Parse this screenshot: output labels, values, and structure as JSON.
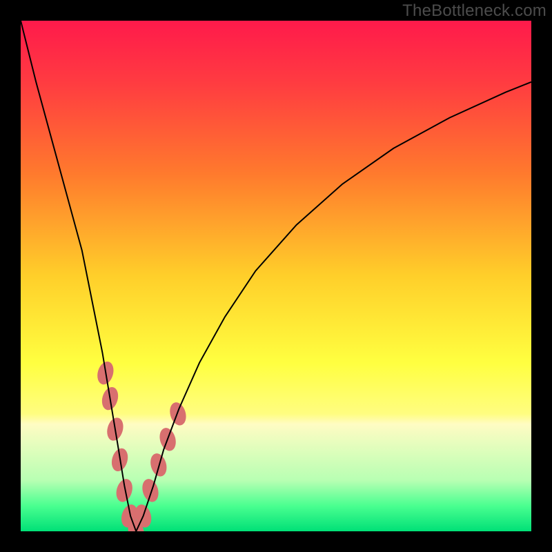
{
  "watermark": "TheBottleneck.com",
  "chart_data": {
    "type": "line",
    "title": "",
    "xlabel": "",
    "ylabel": "",
    "xlim": [
      0,
      100
    ],
    "ylim": [
      0,
      100
    ],
    "grid": false,
    "legend": "none",
    "gradient_stops": [
      {
        "pct": 0,
        "color": "#ff1a4b"
      },
      {
        "pct": 12,
        "color": "#ff3b41"
      },
      {
        "pct": 30,
        "color": "#ff7a2d"
      },
      {
        "pct": 50,
        "color": "#ffcf2a"
      },
      {
        "pct": 67,
        "color": "#ffff40"
      },
      {
        "pct": 77,
        "color": "#fffd80"
      },
      {
        "pct": 79,
        "color": "#fffcc3"
      },
      {
        "pct": 90,
        "color": "#b8ffb3"
      },
      {
        "pct": 95,
        "color": "#4aff90"
      },
      {
        "pct": 100,
        "color": "#00e077"
      }
    ],
    "series": [
      {
        "name": "bottleneck-curve",
        "x": [
          0,
          3,
          6,
          9,
          12,
          14,
          16,
          17.5,
          19,
          20.3,
          21.5,
          22.6,
          24,
          26,
          28,
          31,
          35,
          40,
          46,
          54,
          63,
          73,
          84,
          95,
          100
        ],
        "y": [
          100,
          88,
          77,
          66,
          55,
          45,
          35,
          26,
          17,
          9,
          3,
          0,
          3,
          9,
          16,
          24,
          33,
          42,
          51,
          60,
          68,
          75,
          81,
          86,
          88
        ]
      }
    ],
    "annotations": {
      "beads": [
        {
          "x": 16.6,
          "y": 31
        },
        {
          "x": 17.5,
          "y": 26
        },
        {
          "x": 18.5,
          "y": 20
        },
        {
          "x": 19.4,
          "y": 14
        },
        {
          "x": 20.3,
          "y": 8
        },
        {
          "x": 21.3,
          "y": 3
        },
        {
          "x": 22.6,
          "y": 0
        },
        {
          "x": 24.0,
          "y": 3
        },
        {
          "x": 25.4,
          "y": 8
        },
        {
          "x": 27.0,
          "y": 13
        },
        {
          "x": 28.8,
          "y": 18
        },
        {
          "x": 30.8,
          "y": 23
        }
      ],
      "bead_rx": 1.5,
      "bead_ry": 2.3
    }
  }
}
